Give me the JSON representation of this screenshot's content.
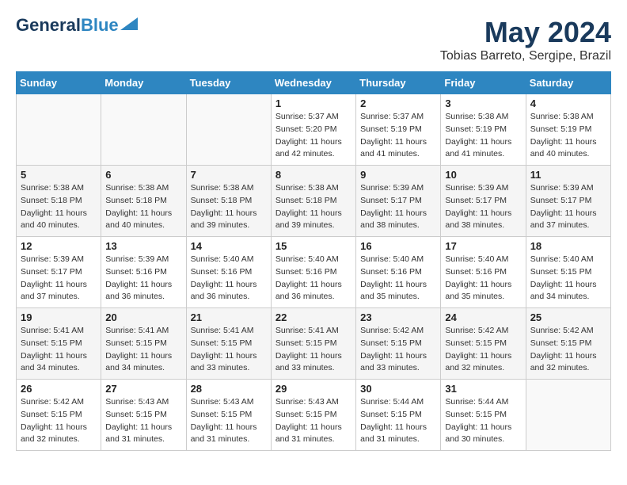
{
  "header": {
    "logo_general": "General",
    "logo_blue": "Blue",
    "month_title": "May 2024",
    "location": "Tobias Barreto, Sergipe, Brazil"
  },
  "days_of_week": [
    "Sunday",
    "Monday",
    "Tuesday",
    "Wednesday",
    "Thursday",
    "Friday",
    "Saturday"
  ],
  "weeks": [
    [
      {
        "day": "",
        "sunrise": "",
        "sunset": "",
        "daylight": ""
      },
      {
        "day": "",
        "sunrise": "",
        "sunset": "",
        "daylight": ""
      },
      {
        "day": "",
        "sunrise": "",
        "sunset": "",
        "daylight": ""
      },
      {
        "day": "1",
        "sunrise": "Sunrise: 5:37 AM",
        "sunset": "Sunset: 5:20 PM",
        "daylight": "Daylight: 11 hours and 42 minutes."
      },
      {
        "day": "2",
        "sunrise": "Sunrise: 5:37 AM",
        "sunset": "Sunset: 5:19 PM",
        "daylight": "Daylight: 11 hours and 41 minutes."
      },
      {
        "day": "3",
        "sunrise": "Sunrise: 5:38 AM",
        "sunset": "Sunset: 5:19 PM",
        "daylight": "Daylight: 11 hours and 41 minutes."
      },
      {
        "day": "4",
        "sunrise": "Sunrise: 5:38 AM",
        "sunset": "Sunset: 5:19 PM",
        "daylight": "Daylight: 11 hours and 40 minutes."
      }
    ],
    [
      {
        "day": "5",
        "sunrise": "Sunrise: 5:38 AM",
        "sunset": "Sunset: 5:18 PM",
        "daylight": "Daylight: 11 hours and 40 minutes."
      },
      {
        "day": "6",
        "sunrise": "Sunrise: 5:38 AM",
        "sunset": "Sunset: 5:18 PM",
        "daylight": "Daylight: 11 hours and 40 minutes."
      },
      {
        "day": "7",
        "sunrise": "Sunrise: 5:38 AM",
        "sunset": "Sunset: 5:18 PM",
        "daylight": "Daylight: 11 hours and 39 minutes."
      },
      {
        "day": "8",
        "sunrise": "Sunrise: 5:38 AM",
        "sunset": "Sunset: 5:18 PM",
        "daylight": "Daylight: 11 hours and 39 minutes."
      },
      {
        "day": "9",
        "sunrise": "Sunrise: 5:39 AM",
        "sunset": "Sunset: 5:17 PM",
        "daylight": "Daylight: 11 hours and 38 minutes."
      },
      {
        "day": "10",
        "sunrise": "Sunrise: 5:39 AM",
        "sunset": "Sunset: 5:17 PM",
        "daylight": "Daylight: 11 hours and 38 minutes."
      },
      {
        "day": "11",
        "sunrise": "Sunrise: 5:39 AM",
        "sunset": "Sunset: 5:17 PM",
        "daylight": "Daylight: 11 hours and 37 minutes."
      }
    ],
    [
      {
        "day": "12",
        "sunrise": "Sunrise: 5:39 AM",
        "sunset": "Sunset: 5:17 PM",
        "daylight": "Daylight: 11 hours and 37 minutes."
      },
      {
        "day": "13",
        "sunrise": "Sunrise: 5:39 AM",
        "sunset": "Sunset: 5:16 PM",
        "daylight": "Daylight: 11 hours and 36 minutes."
      },
      {
        "day": "14",
        "sunrise": "Sunrise: 5:40 AM",
        "sunset": "Sunset: 5:16 PM",
        "daylight": "Daylight: 11 hours and 36 minutes."
      },
      {
        "day": "15",
        "sunrise": "Sunrise: 5:40 AM",
        "sunset": "Sunset: 5:16 PM",
        "daylight": "Daylight: 11 hours and 36 minutes."
      },
      {
        "day": "16",
        "sunrise": "Sunrise: 5:40 AM",
        "sunset": "Sunset: 5:16 PM",
        "daylight": "Daylight: 11 hours and 35 minutes."
      },
      {
        "day": "17",
        "sunrise": "Sunrise: 5:40 AM",
        "sunset": "Sunset: 5:16 PM",
        "daylight": "Daylight: 11 hours and 35 minutes."
      },
      {
        "day": "18",
        "sunrise": "Sunrise: 5:40 AM",
        "sunset": "Sunset: 5:15 PM",
        "daylight": "Daylight: 11 hours and 34 minutes."
      }
    ],
    [
      {
        "day": "19",
        "sunrise": "Sunrise: 5:41 AM",
        "sunset": "Sunset: 5:15 PM",
        "daylight": "Daylight: 11 hours and 34 minutes."
      },
      {
        "day": "20",
        "sunrise": "Sunrise: 5:41 AM",
        "sunset": "Sunset: 5:15 PM",
        "daylight": "Daylight: 11 hours and 34 minutes."
      },
      {
        "day": "21",
        "sunrise": "Sunrise: 5:41 AM",
        "sunset": "Sunset: 5:15 PM",
        "daylight": "Daylight: 11 hours and 33 minutes."
      },
      {
        "day": "22",
        "sunrise": "Sunrise: 5:41 AM",
        "sunset": "Sunset: 5:15 PM",
        "daylight": "Daylight: 11 hours and 33 minutes."
      },
      {
        "day": "23",
        "sunrise": "Sunrise: 5:42 AM",
        "sunset": "Sunset: 5:15 PM",
        "daylight": "Daylight: 11 hours and 33 minutes."
      },
      {
        "day": "24",
        "sunrise": "Sunrise: 5:42 AM",
        "sunset": "Sunset: 5:15 PM",
        "daylight": "Daylight: 11 hours and 32 minutes."
      },
      {
        "day": "25",
        "sunrise": "Sunrise: 5:42 AM",
        "sunset": "Sunset: 5:15 PM",
        "daylight": "Daylight: 11 hours and 32 minutes."
      }
    ],
    [
      {
        "day": "26",
        "sunrise": "Sunrise: 5:42 AM",
        "sunset": "Sunset: 5:15 PM",
        "daylight": "Daylight: 11 hours and 32 minutes."
      },
      {
        "day": "27",
        "sunrise": "Sunrise: 5:43 AM",
        "sunset": "Sunset: 5:15 PM",
        "daylight": "Daylight: 11 hours and 31 minutes."
      },
      {
        "day": "28",
        "sunrise": "Sunrise: 5:43 AM",
        "sunset": "Sunset: 5:15 PM",
        "daylight": "Daylight: 11 hours and 31 minutes."
      },
      {
        "day": "29",
        "sunrise": "Sunrise: 5:43 AM",
        "sunset": "Sunset: 5:15 PM",
        "daylight": "Daylight: 11 hours and 31 minutes."
      },
      {
        "day": "30",
        "sunrise": "Sunrise: 5:44 AM",
        "sunset": "Sunset: 5:15 PM",
        "daylight": "Daylight: 11 hours and 31 minutes."
      },
      {
        "day": "31",
        "sunrise": "Sunrise: 5:44 AM",
        "sunset": "Sunset: 5:15 PM",
        "daylight": "Daylight: 11 hours and 30 minutes."
      },
      {
        "day": "",
        "sunrise": "",
        "sunset": "",
        "daylight": ""
      }
    ]
  ]
}
